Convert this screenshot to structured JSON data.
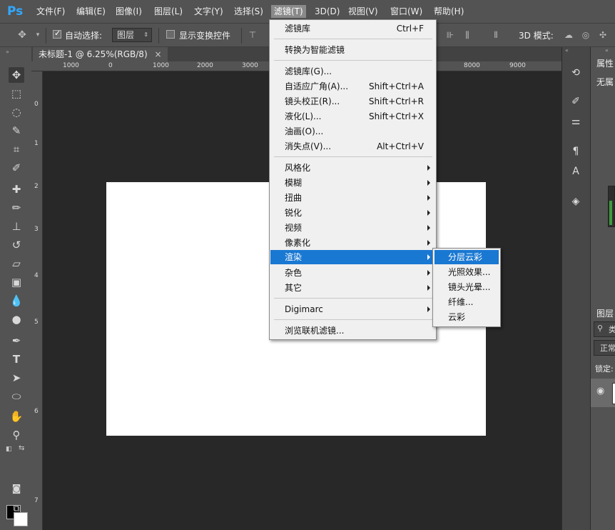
{
  "app": {
    "logo": "Ps"
  },
  "menubar": {
    "items": [
      "文件(F)",
      "编辑(E)",
      "图像(I)",
      "图层(L)",
      "文字(Y)",
      "选择(S)",
      "滤镜(T)",
      "3D(D)",
      "视图(V)",
      "窗口(W)",
      "帮助(H)"
    ],
    "active_index": 6
  },
  "options_bar": {
    "auto_select_label": "自动选择:",
    "auto_select_checked": true,
    "auto_select_value": "图层",
    "show_transform_label": "显示变换控件",
    "show_transform_checked": false,
    "mode_3d_label": "3D 模式:"
  },
  "document": {
    "tab_title": "未标题-1 @ 6.25%(RGB/8)",
    "close_glyph": "×",
    "ruler_h_labels": [
      "1000",
      "0",
      "1000",
      "2000",
      "3000",
      "8000",
      "9000"
    ],
    "ruler_v_labels": [
      "0",
      "1",
      "2",
      "3",
      "4",
      "5",
      "6",
      "7"
    ]
  },
  "filter_menu": {
    "groups": [
      [
        {
          "label": "滤镜库",
          "shortcut": "Ctrl+F"
        }
      ],
      [
        {
          "label": "转换为智能滤镜"
        }
      ],
      [
        {
          "label": "滤镜库(G)..."
        },
        {
          "label": "自适应广角(A)...",
          "shortcut": "Shift+Ctrl+A"
        },
        {
          "label": "镜头校正(R)...",
          "shortcut": "Shift+Ctrl+R"
        },
        {
          "label": "液化(L)...",
          "shortcut": "Shift+Ctrl+X"
        },
        {
          "label": "油画(O)..."
        },
        {
          "label": "消失点(V)...",
          "shortcut": "Alt+Ctrl+V"
        }
      ],
      [
        {
          "label": "风格化",
          "submenu": true
        },
        {
          "label": "模糊",
          "submenu": true
        },
        {
          "label": "扭曲",
          "submenu": true
        },
        {
          "label": "锐化",
          "submenu": true
        },
        {
          "label": "视频",
          "submenu": true
        },
        {
          "label": "像素化",
          "submenu": true
        },
        {
          "label": "渲染",
          "submenu": true,
          "highlighted": true
        },
        {
          "label": "杂色",
          "submenu": true
        },
        {
          "label": "其它",
          "submenu": true
        }
      ],
      [
        {
          "label": "Digimarc",
          "submenu": true
        }
      ],
      [
        {
          "label": "浏览联机滤镜..."
        }
      ]
    ]
  },
  "render_submenu": {
    "items": [
      "分层云彩",
      "光照效果...",
      "镜头光晕...",
      "纤维...",
      "云彩"
    ],
    "highlighted_index": 0
  },
  "right_panels": {
    "properties_title": "属性",
    "properties_text": "无属",
    "layers_title": "图层",
    "layers_search_placeholder": "类",
    "blend_mode": "正常",
    "lock_label": "锁定:"
  },
  "colors": {
    "accent_highlight": "#1978d2",
    "menubar_bg": "#535353",
    "workspace_bg": "#282828",
    "canvas_bg": "#ffffff",
    "menu_bg": "#f0f0f0"
  }
}
